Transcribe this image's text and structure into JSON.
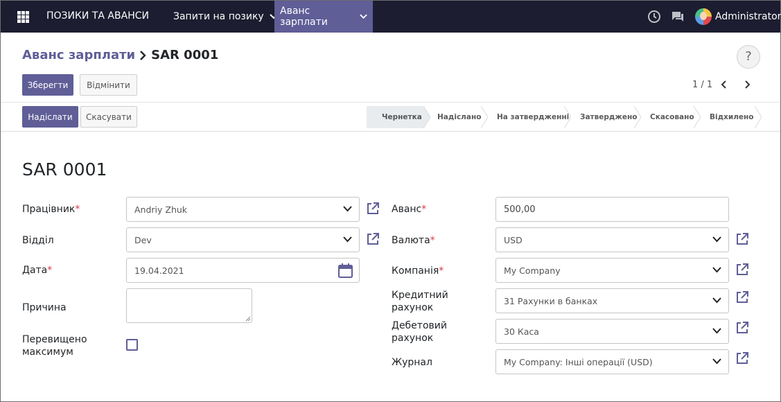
{
  "navbar": {
    "brand": "ПОЗИКИ ТА АВАНСИ",
    "menus": [
      "Запити на позику",
      "Аванс зарплати"
    ],
    "user": "Administrator"
  },
  "breadcrumb": {
    "parent": "Аванс зарплати",
    "current": "SAR 0001"
  },
  "buttons": {
    "save": "Зберегти",
    "discard": "Відмінити",
    "submit": "Надіслати",
    "cancel": "Скасувати",
    "help": "?"
  },
  "pager": {
    "value": "1 / 1"
  },
  "statusbar": {
    "stages": [
      "Чернетка",
      "Надіслано",
      "На затвердженні",
      "Затверджено",
      "Скасовано",
      "Відхилено"
    ],
    "current": "Чернетка"
  },
  "record": {
    "title": "SAR 0001",
    "fields": {
      "employee": {
        "label": "Працівник",
        "value": "Andriy Zhuk"
      },
      "department": {
        "label": "Відділ",
        "value": "Dev"
      },
      "date": {
        "label": "Дата",
        "value": "19.04.2021"
      },
      "reason": {
        "label": "Причина",
        "value": ""
      },
      "exceed": {
        "label": "Перевищено максимум",
        "checked": false
      },
      "advance": {
        "label": "Аванс",
        "value": "500,00"
      },
      "currency": {
        "label": "Валюта",
        "value": "USD"
      },
      "company": {
        "label": "Компанія",
        "value": "My Company"
      },
      "credit_account": {
        "label": "Кредитний рахунок",
        "value": "31 Рахунки в банках"
      },
      "debit_account": {
        "label": "Дебетовий рахунок",
        "value": "30 Каса"
      },
      "journal": {
        "label": "Журнал",
        "value": "My Company: Інші операції (USD)"
      }
    }
  },
  "colors": {
    "navbar": "#1c1d30",
    "active_menu": "#5f5e97",
    "primary": "#5f5e97",
    "required": "#d9364a"
  }
}
